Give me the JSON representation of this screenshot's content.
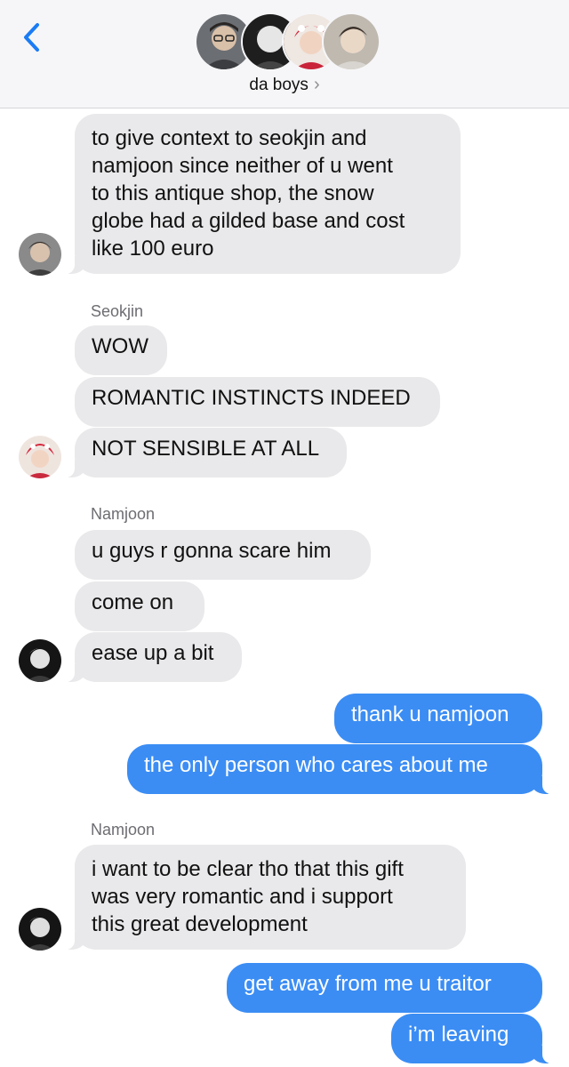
{
  "header": {
    "group_name": "da boys",
    "chevron": "›",
    "back_icon": "chevron-left-icon",
    "accent_color": "#1a7cf5"
  },
  "messages": [
    {
      "from": "",
      "direction": "incoming",
      "text": "to give context to seokjin and\nnamjoon since neither of u went\nto this antique shop, the snow\nglobe had a gilded base and cost\nlike 100 euro"
    },
    {
      "from": "Seokjin",
      "direction": "incoming",
      "text": "WOW"
    },
    {
      "from": "Seokjin",
      "direction": "incoming",
      "text": "ROMANTIC INSTINCTS INDEED"
    },
    {
      "from": "Seokjin",
      "direction": "incoming",
      "text": "NOT SENSIBLE AT ALL"
    },
    {
      "from": "Namjoon",
      "direction": "incoming",
      "text": "u guys r gonna scare him"
    },
    {
      "from": "Namjoon",
      "direction": "incoming",
      "text": "come on"
    },
    {
      "from": "Namjoon",
      "direction": "incoming",
      "text": "ease up a bit"
    },
    {
      "from": "me",
      "direction": "outgoing",
      "text": "thank u namjoon"
    },
    {
      "from": "me",
      "direction": "outgoing",
      "text": "the only person who cares about me"
    },
    {
      "from": "Namjoon",
      "direction": "incoming",
      "text": "i want to be clear tho that this gift\nwas very romantic and i support\nthis great development"
    },
    {
      "from": "me",
      "direction": "outgoing",
      "text": "get away from me u traitor"
    },
    {
      "from": "me",
      "direction": "outgoing",
      "text": "i’m leaving"
    }
  ],
  "sender_labels": {
    "seokjin": "Seokjin",
    "namjoon_1": "Namjoon",
    "namjoon_2": "Namjoon"
  },
  "colors": {
    "incoming_bubble": "#e9e9eb",
    "outgoing_bubble": "#3b8df4",
    "header_bg": "#f6f6f8"
  }
}
